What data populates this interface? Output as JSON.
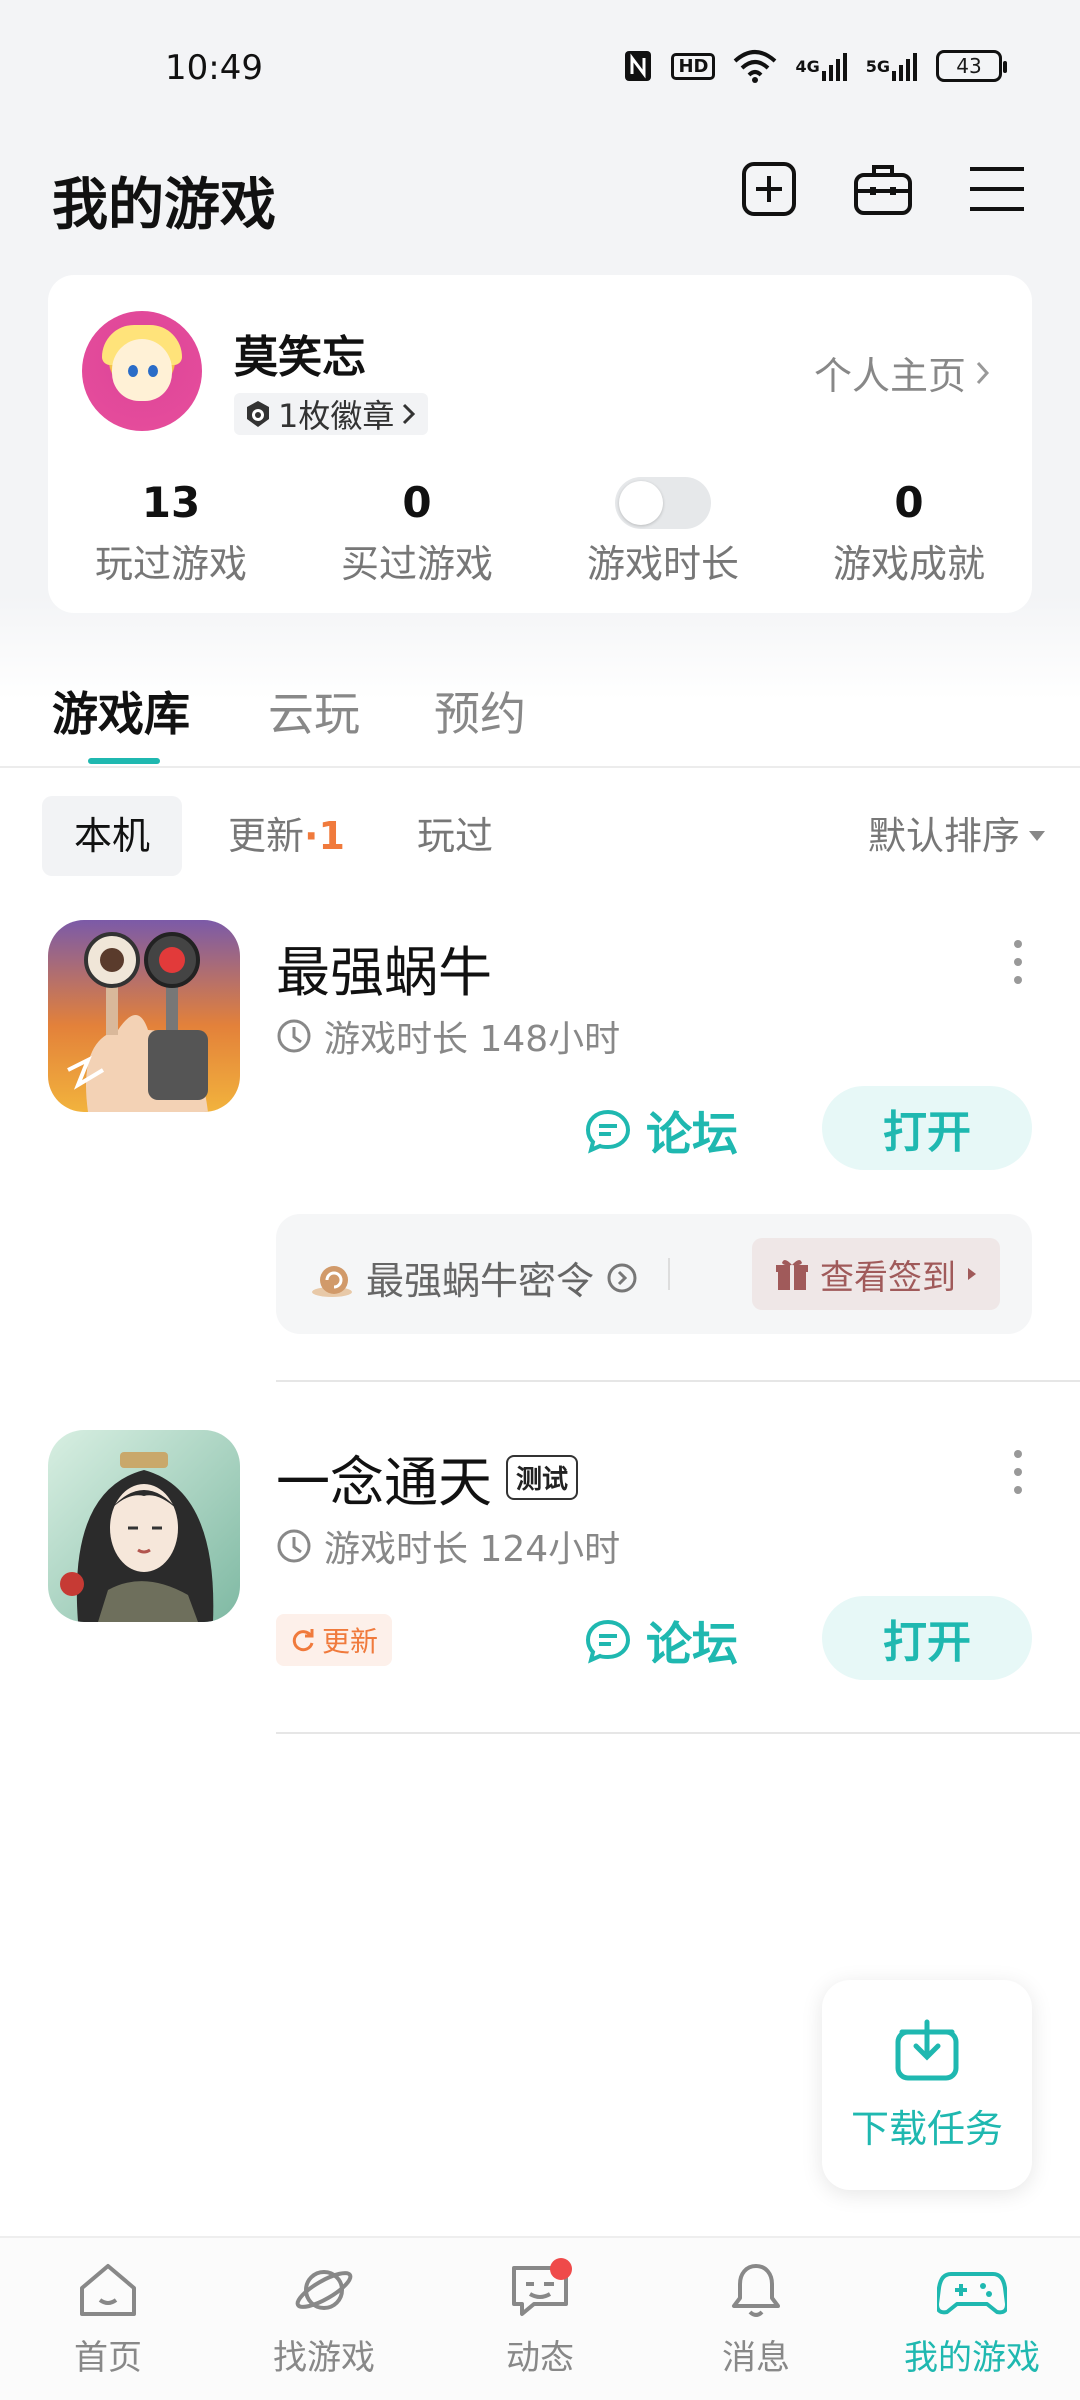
{
  "status_bar": {
    "time": "10:49",
    "icons": [
      "nfc-icon",
      "hd-icon",
      "wifi-icon",
      "4g-signal-icon",
      "5g-signal-icon"
    ],
    "hd_label": "HD",
    "sig1_label": "4G",
    "sig2_label": "5G",
    "battery": "43"
  },
  "header": {
    "title": "我的游戏",
    "actions": [
      "add-game-icon",
      "toolbox-icon",
      "menu-icon"
    ]
  },
  "profile": {
    "name": "莫笑忘",
    "badge": "1枚徽章",
    "homepage_link": "个人主页",
    "stats": [
      {
        "value": "13",
        "label": "玩过游戏"
      },
      {
        "value": "0",
        "label": "买过游戏"
      },
      {
        "value": "",
        "label": "游戏时长",
        "toggle_on": false
      },
      {
        "value": "0",
        "label": "游戏成就"
      }
    ]
  },
  "tabs": [
    {
      "label": "游戏库",
      "active": true
    },
    {
      "label": "云玩",
      "active": false
    },
    {
      "label": "预约",
      "active": false
    }
  ],
  "filters": {
    "chips": [
      {
        "label": "本机",
        "active": true
      },
      {
        "label": "更新",
        "count": "·1",
        "active": false
      },
      {
        "label": "玩过",
        "active": false
      }
    ],
    "sort": "默认排序"
  },
  "games": [
    {
      "name": "最强蜗牛",
      "playtime": "游戏时长 148小时",
      "forum": "论坛",
      "open": "打开",
      "notice": "最强蜗牛密令",
      "checkin": "查看签到"
    },
    {
      "name": "一念通天",
      "tag": "测试",
      "playtime": "游戏时长 124小时",
      "update": "更新",
      "forum": "论坛",
      "open": "打开"
    }
  ],
  "download_task": {
    "label": "下载任务"
  },
  "bottom_nav": [
    {
      "label": "首页",
      "icon": "home-icon",
      "active": false
    },
    {
      "label": "找游戏",
      "icon": "planet-icon",
      "active": false
    },
    {
      "label": "动态",
      "icon": "chat-icon",
      "active": false,
      "dot": true
    },
    {
      "label": "消息",
      "icon": "bell-icon",
      "active": false
    },
    {
      "label": "我的游戏",
      "icon": "gamepad-icon",
      "active": true
    }
  ],
  "colors": {
    "accent": "#1fb8b0",
    "update": "#f07a3c",
    "notification_dot": "#ef4a4a"
  }
}
